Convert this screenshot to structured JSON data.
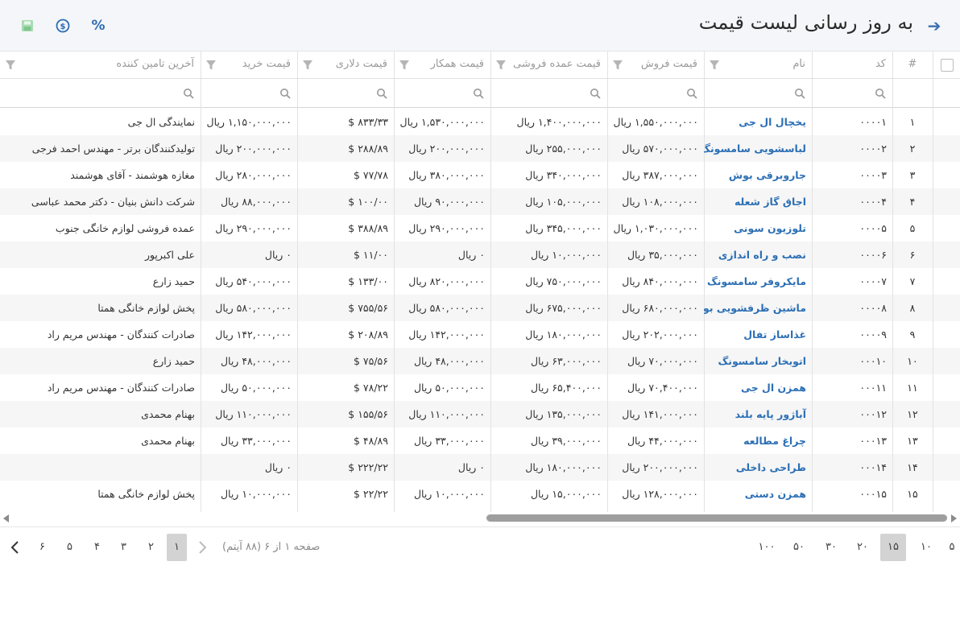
{
  "header": {
    "title": "به روز رسانی لیست قیمت",
    "percent_label": "%",
    "back_icon": "arrow-right-icon",
    "save_icon": "save-icon",
    "dollar_icon": "dollar-circle-icon",
    "accent": "#2f6db3"
  },
  "columns": {
    "num": "#",
    "code": "کد",
    "name": "نام",
    "sale": "قیمت فروش",
    "wholesale": "قیمت عمده فروشی",
    "partner": "قیمت همکار",
    "dollar": "قیمت دلاری",
    "purchase": "قیمت خرید",
    "supplier": "آخرین تامین کننده"
  },
  "rows": [
    {
      "num": "۱",
      "code": "۰۰۰۰۱",
      "name": "یخچال ال جی",
      "sale": "۱,۵۵۰,۰۰۰,۰۰۰ ریال",
      "wholesale": "۱,۴۰۰,۰۰۰,۰۰۰ ریال",
      "partner": "۱,۵۳۰,۰۰۰,۰۰۰ ریال",
      "dollar": "۸۳۳/۳۳ $",
      "purchase": "۱,۱۵۰,۰۰۰,۰۰۰ ریال",
      "supplier": "نمایندگی ال جی"
    },
    {
      "num": "۲",
      "code": "۰۰۰۰۲",
      "name": "لباسشویی سامسونگ",
      "sale": "۵۷۰,۰۰۰,۰۰۰ ریال",
      "wholesale": "۲۵۵,۰۰۰,۰۰۰ ریال",
      "partner": "۲۰۰,۰۰۰,۰۰۰ ریال",
      "dollar": "۲۸۸/۸۹ $",
      "purchase": "۲۰۰,۰۰۰,۰۰۰ ریال",
      "supplier": "تولیدکنندگان برتر - مهندس احمد فرجی"
    },
    {
      "num": "۳",
      "code": "۰۰۰۰۳",
      "name": "جاروبرقی بوش",
      "sale": "۳۸۷,۰۰۰,۰۰۰ ریال",
      "wholesale": "۳۴۰,۰۰۰,۰۰۰ ریال",
      "partner": "۳۸۰,۰۰۰,۰۰۰ ریال",
      "dollar": "۷۷/۷۸ $",
      "purchase": "۲۸۰,۰۰۰,۰۰۰ ریال",
      "supplier": "مغازه هوشمند - آقای هوشمند"
    },
    {
      "num": "۴",
      "code": "۰۰۰۰۴",
      "name": "اجاق گاز شعله",
      "sale": "۱۰۸,۰۰۰,۰۰۰ ریال",
      "wholesale": "۱۰۵,۰۰۰,۰۰۰ ریال",
      "partner": "۹۰,۰۰۰,۰۰۰ ریال",
      "dollar": "۱۰۰/۰۰ $",
      "purchase": "۸۸,۰۰۰,۰۰۰ ریال",
      "supplier": "شرکت دانش بنیان - دکتر محمد عباسی"
    },
    {
      "num": "۵",
      "code": "۰۰۰۰۵",
      "name": "تلوزیون سونی",
      "sale": "۱,۰۳۰,۰۰۰,۰۰۰ ریال",
      "wholesale": "۳۴۵,۰۰۰,۰۰۰ ریال",
      "partner": "۲۹۰,۰۰۰,۰۰۰ ریال",
      "dollar": "۳۸۸/۸۹ $",
      "purchase": "۲۹۰,۰۰۰,۰۰۰ ریال",
      "supplier": "عمده فروشی لوازم خانگی جنوب"
    },
    {
      "num": "۶",
      "code": "۰۰۰۰۶",
      "name": "نصب و راه اندازی",
      "sale": "۳۵,۰۰۰,۰۰۰ ریال",
      "wholesale": "۱۰,۰۰۰,۰۰۰ ریال",
      "partner": "۰ ریال",
      "dollar": "۱۱/۰۰ $",
      "purchase": "۰ ریال",
      "supplier": "علی اکبرپور"
    },
    {
      "num": "۷",
      "code": "۰۰۰۰۷",
      "name": "مایکروفر سامسونگ",
      "sale": "۸۴۰,۰۰۰,۰۰۰ ریال",
      "wholesale": "۷۵۰,۰۰۰,۰۰۰ ریال",
      "partner": "۸۲۰,۰۰۰,۰۰۰ ریال",
      "dollar": "۱۳۳/۰۰ $",
      "purchase": "۵۴۰,۰۰۰,۰۰۰ ریال",
      "supplier": "حمید زارع"
    },
    {
      "num": "۸",
      "code": "۰۰۰۰۸",
      "name": "ماشین ظرفشویی بوش",
      "sale": "۶۸۰,۰۰۰,۰۰۰ ریال",
      "wholesale": "۶۷۵,۰۰۰,۰۰۰ ریال",
      "partner": "۵۸۰,۰۰۰,۰۰۰ ریال",
      "dollar": "۷۵۵/۵۶ $",
      "purchase": "۵۸۰,۰۰۰,۰۰۰ ریال",
      "supplier": "پخش لوازم خانگی همتا"
    },
    {
      "num": "۹",
      "code": "۰۰۰۰۹",
      "name": "غذاساز تفال",
      "sale": "۲۰۲,۰۰۰,۰۰۰ ریال",
      "wholesale": "۱۸۰,۰۰۰,۰۰۰ ریال",
      "partner": "۱۴۲,۰۰۰,۰۰۰ ریال",
      "dollar": "۲۰۸/۸۹ $",
      "purchase": "۱۴۲,۰۰۰,۰۰۰ ریال",
      "supplier": "صادرات کنندگان - مهندس مریم راد"
    },
    {
      "num": "۱۰",
      "code": "۰۰۰۱۰",
      "name": "اتوبخار سامسونگ",
      "sale": "۷۰,۰۰۰,۰۰۰ ریال",
      "wholesale": "۶۳,۰۰۰,۰۰۰ ریال",
      "partner": "۴۸,۰۰۰,۰۰۰ ریال",
      "dollar": "۷۵/۵۶ $",
      "purchase": "۴۸,۰۰۰,۰۰۰ ریال",
      "supplier": "حمید زارع"
    },
    {
      "num": "۱۱",
      "code": "۰۰۰۱۱",
      "name": "همزن ال جی",
      "sale": "۷۰,۴۰۰,۰۰۰ ریال",
      "wholesale": "۶۵,۴۰۰,۰۰۰ ریال",
      "partner": "۵۰,۰۰۰,۰۰۰ ریال",
      "dollar": "۷۸/۲۲ $",
      "purchase": "۵۰,۰۰۰,۰۰۰ ریال",
      "supplier": "صادرات کنندگان - مهندس مریم راد"
    },
    {
      "num": "۱۲",
      "code": "۰۰۰۱۲",
      "name": "آباژور پایه بلند",
      "sale": "۱۴۱,۰۰۰,۰۰۰ ریال",
      "wholesale": "۱۳۵,۰۰۰,۰۰۰ ریال",
      "partner": "۱۱۰,۰۰۰,۰۰۰ ریال",
      "dollar": "۱۵۵/۵۶ $",
      "purchase": "۱۱۰,۰۰۰,۰۰۰ ریال",
      "supplier": "بهنام محمدی"
    },
    {
      "num": "۱۳",
      "code": "۰۰۰۱۳",
      "name": "چراغ مطالعه",
      "sale": "۴۴,۰۰۰,۰۰۰ ریال",
      "wholesale": "۳۹,۰۰۰,۰۰۰ ریال",
      "partner": "۳۳,۰۰۰,۰۰۰ ریال",
      "dollar": "۴۸/۸۹ $",
      "purchase": "۳۳,۰۰۰,۰۰۰ ریال",
      "supplier": "بهنام محمدی"
    },
    {
      "num": "۱۴",
      "code": "۰۰۰۱۴",
      "name": "طراحی داخلی",
      "sale": "۲۰۰,۰۰۰,۰۰۰ ریال",
      "wholesale": "۱۸۰,۰۰۰,۰۰۰ ریال",
      "partner": "۰ ریال",
      "dollar": "۲۲۲/۲۲ $",
      "purchase": "۰ ریال",
      "supplier": ""
    },
    {
      "num": "۱۵",
      "code": "۰۰۰۱۵",
      "name": "همزن دستی",
      "sale": "۱۲۸,۰۰۰,۰۰۰ ریال",
      "wholesale": "۱۵,۰۰۰,۰۰۰ ریال",
      "partner": "۱۰,۰۰۰,۰۰۰ ریال",
      "dollar": "۲۲/۲۲ $",
      "purchase": "۱۰,۰۰۰,۰۰۰ ریال",
      "supplier": "پخش لوازم خانگی همتا"
    }
  ],
  "pager": {
    "sizes": [
      "۵",
      "۱۰",
      "۱۵",
      "۲۰",
      "۳۰",
      "۵۰",
      "۱۰۰"
    ],
    "active_size": "۱۵",
    "info": "صفحه ۱ از ۶ (۸۸ آیتم)",
    "pages": [
      "۱",
      "۲",
      "۳",
      "۴",
      "۵",
      "۶"
    ],
    "active_page": "۱"
  },
  "colors": {
    "accent": "#2f6db3",
    "name_link": "#2c6fb4",
    "save_icon": "#9fd6a8",
    "row_alt": "#f6f6f6"
  }
}
